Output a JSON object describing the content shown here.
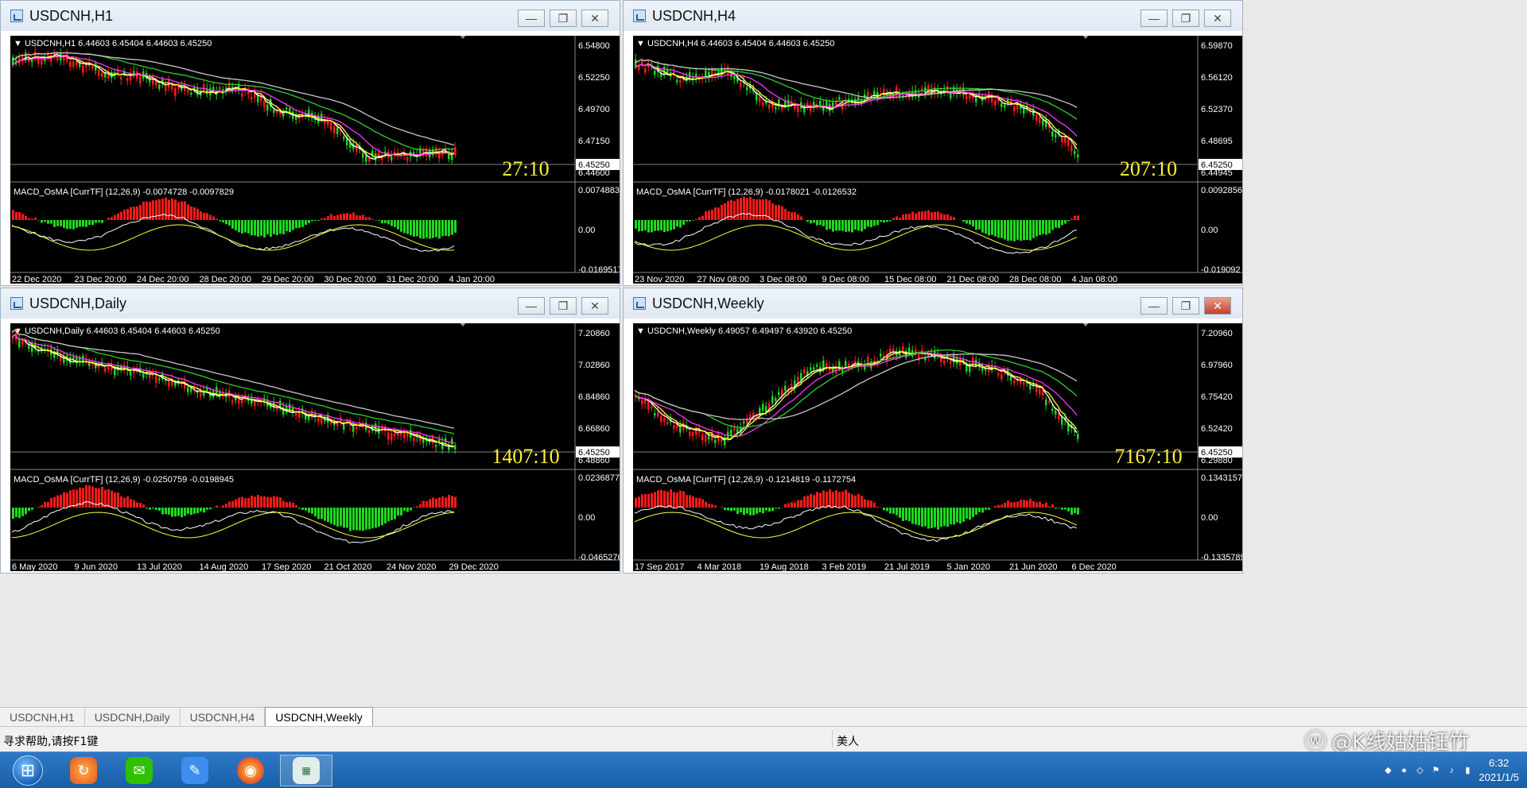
{
  "charts": [
    {
      "id": "h1",
      "window_title": "USDCNH,H1",
      "header": "USDCNH,H1  6.44603 6.45404 6.44603 6.45250",
      "price_ticks": [
        "6.54800",
        "6.52250",
        "6.49700",
        "6.47150",
        "6.44600"
      ],
      "current_price": "6.45250",
      "countdown": "27:10",
      "macd_header": "MACD_OsMA [CurrTF] (12,26,9) -0.0074728 -0.0097829",
      "macd_ticks": [
        "0.0074883",
        "0.00",
        "-0.0169517"
      ],
      "dates": [
        "22 Dec 2020",
        "23 Dec 20:00",
        "24 Dec 20:00",
        "28 Dec 20:00",
        "29 Dec 20:00",
        "30 Dec 20:00",
        "31 Dec 20:00",
        "4 Jan 20:00"
      ]
    },
    {
      "id": "h4",
      "window_title": "USDCNH,H4",
      "header": "USDCNH,H4  6.44603 6.45404 6.44603 6.45250",
      "price_ticks": [
        "6.59870",
        "6.56120",
        "6.52370",
        "6.48695",
        "6.44945"
      ],
      "current_price": "6.45250",
      "countdown": "207:10",
      "macd_header": "MACD_OsMA [CurrTF] (12,26,9) -0.0178021 -0.0126532",
      "macd_ticks": [
        "0.0092856",
        "0.00",
        "-0.019092"
      ],
      "dates": [
        "23 Nov 2020",
        "27 Nov 08:00",
        "3 Dec 08:00",
        "9 Dec 08:00",
        "15 Dec 08:00",
        "21 Dec 08:00",
        "28 Dec 08:00",
        "4 Jan 08:00"
      ]
    },
    {
      "id": "daily",
      "window_title": "USDCNH,Daily",
      "header": "USDCNH,Daily  6.44603 6.45404 6.44603 6.45250",
      "price_ticks": [
        "7.20860",
        "7.02860",
        "6.84860",
        "6.66860",
        "6.48860"
      ],
      "current_price": "6.45250",
      "countdown": "1407:10",
      "macd_header": "MACD_OsMA [CurrTF] (12,26,9) -0.0250759 -0.0198945",
      "macd_ticks": [
        "0.0236877",
        "0.00",
        "-0.0465276"
      ],
      "dates": [
        "6 May 2020",
        "9 Jun 2020",
        "13 Jul 2020",
        "14 Aug 2020",
        "17 Sep 2020",
        "21 Oct 2020",
        "24 Nov 2020",
        "29 Dec 2020"
      ]
    },
    {
      "id": "weekly",
      "window_title": "USDCNH,Weekly",
      "header": "USDCNH,Weekly  6.49057 6.49497 6.43920 6.45250",
      "price_ticks": [
        "7.20960",
        "6.97960",
        "6.75420",
        "6.52420",
        "6.29880"
      ],
      "current_price": "6.45250",
      "countdown": "7167:10",
      "macd_header": "MACD_OsMA [CurrTF] (12,26,9) -0.1214819 -0.1172754",
      "macd_ticks": [
        "0.1343157",
        "0.00",
        "-0.1335789"
      ],
      "dates": [
        "17 Sep 2017",
        "4 Mar 2018",
        "19 Aug 2018",
        "3 Feb 2019",
        "21 Jul 2019",
        "5 Jan 2020",
        "21 Jun 2020",
        "6 Dec 2020"
      ]
    }
  ],
  "tabs": [
    "USDCNH,H1",
    "USDCNH,Daily",
    "USDCNH,H4",
    "USDCNH,Weekly"
  ],
  "active_tab": "USDCNH,Weekly",
  "status": {
    "help_text": "寻求帮助,请按F1键",
    "profile": "美人"
  },
  "watermark": "@K线姑姑钰竹",
  "clock": {
    "time": "6:32",
    "date": "2021/1/5"
  },
  "colors": {
    "chart_bg": "#000000",
    "bull": "#ff1a1a",
    "bear": "#1ed91e",
    "ma_fast": "#ffffff",
    "ma_yellow": "#ffff33",
    "ma_magenta": "#ff33ff",
    "ma_green": "#33cc33",
    "ma_grey": "#c8c8c8",
    "countdown": "#ffee33"
  }
}
